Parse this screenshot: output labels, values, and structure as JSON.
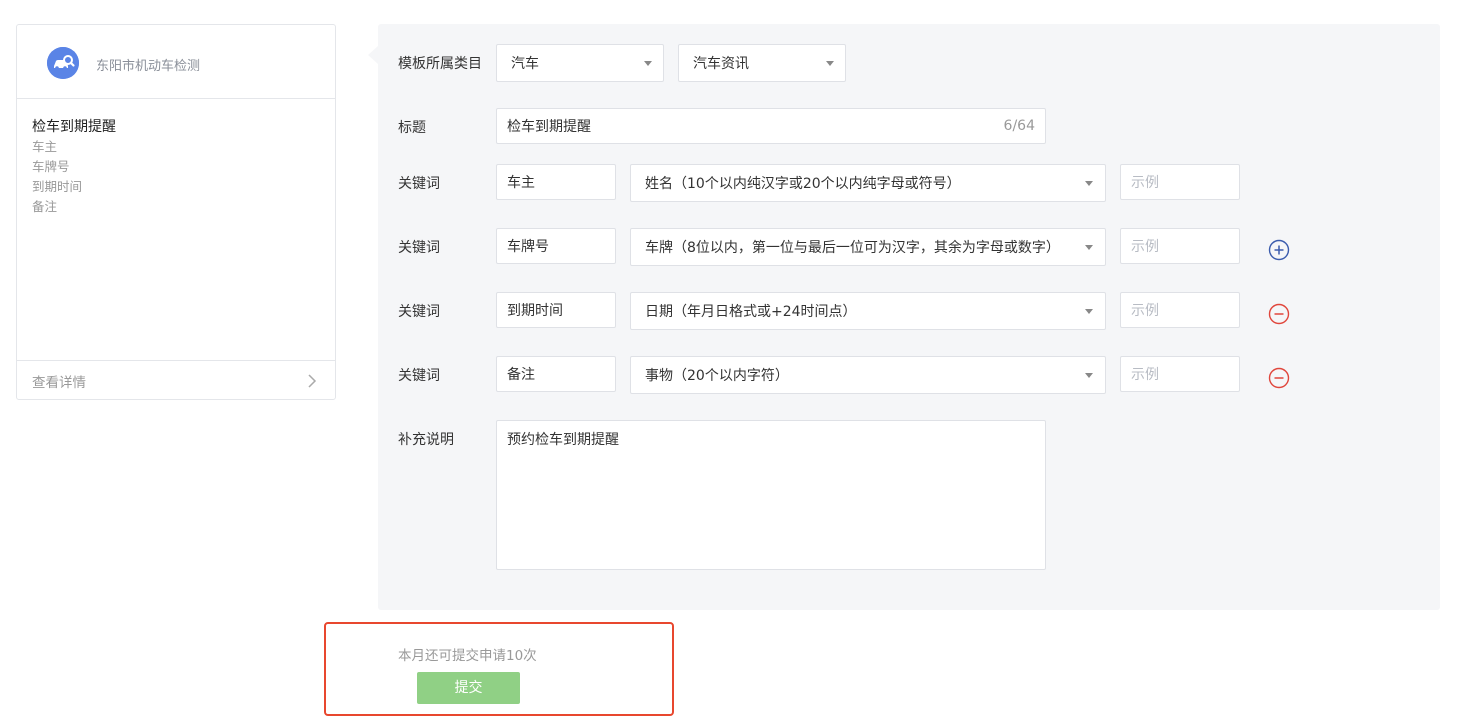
{
  "preview": {
    "org_name": "东阳市机动车检测",
    "title": "检车到期提醒",
    "fields": [
      "车主",
      "车牌号",
      "到期时间",
      "备注"
    ],
    "detail_link": "查看详情"
  },
  "form": {
    "category_label": "模板所属类目",
    "category_primary": "汽车",
    "category_secondary": "汽车资讯",
    "title_label": "标题",
    "title_value": "检车到期提醒",
    "title_count": "6/64",
    "keyword_label": "关键词",
    "example_placeholder": "示例",
    "keywords": [
      {
        "name": "车主",
        "type": "姓名（10个以内纯汉字或20个以内纯字母或符号）",
        "action": "none"
      },
      {
        "name": "车牌号",
        "type": "车牌（8位以内，第一位与最后一位可为汉字，其余为字母或数字）",
        "action": "add"
      },
      {
        "name": "到期时间",
        "type": "日期（年月日格式或+24时间点）",
        "action": "remove"
      },
      {
        "name": "备注",
        "type": "事物（20个以内字符）",
        "action": "remove"
      }
    ],
    "note_label": "补充说明",
    "note_value": "预约检车到期提醒"
  },
  "submit": {
    "quota_text": "本月还可提交申请10次",
    "button_label": "提交",
    "button_color": "#90d085",
    "highlight_color": "#e8472e"
  },
  "colors": {
    "add_icon": "#3b5cad",
    "remove_icon": "#e0463c",
    "avatar": "#5a84e6"
  }
}
